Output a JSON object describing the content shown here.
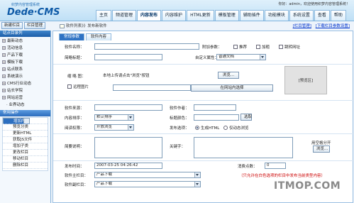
{
  "app": {
    "logo_sub": "织梦内容管理系统",
    "logo_main": "Dede·CMS"
  },
  "greeting": {
    "text": "你好：admin，欢迎使用织梦内容管理系统！"
  },
  "nav": [
    "主页",
    "频道管理",
    "内容发布",
    "内容维护",
    "HTML更新",
    "模板管理",
    "辅助插件",
    "功能模块",
    "系统设置",
    "查看",
    "帮助"
  ],
  "nav_active": 2,
  "top_buttons": {
    "new": "新建栏目",
    "manage": "栏目管理"
  },
  "breadcrumb": "软件列表》》发布新软件",
  "right_links": [
    "[栏目管理]",
    "[下载栏目参数设置]"
  ],
  "sidebar": {
    "header": "站点目录列",
    "tree": [
      "最新动态",
      "活动信息",
      "产品下载",
      "模板下载",
      "站点联系",
      "系统演示",
      "CMS行业动态",
      "站长学院",
      "网站运营"
    ],
    "tree_last": "· 业界动态",
    "section": "常用操作",
    "items": [
      "增加内容",
      "管理内容",
      "预览分类",
      "更新HTML",
      "获取JS文件",
      "增加子类",
      "更改栏目",
      "移动栏目",
      "删除栏目"
    ],
    "selected": 0
  },
  "tabs": [
    "常规参数",
    "软件内容"
  ],
  "form": {
    "software_name_label": "软件名称：",
    "attr_label": "附加参数：",
    "attr_opts": [
      "推荐",
      "加粗",
      "跳转网址"
    ],
    "brief_title_label": "简略标题：",
    "custom_attr_label": "自定义属性：",
    "custom_attr_value": "普通文档",
    "thumb_label": "缩 略 图：",
    "thumb_hint": "本地上传请点击\"浏览\"按钮",
    "browse": "浏览...",
    "remote_pic": "远程图片",
    "select_btn": "在网站内选择",
    "preview": "[预览区]",
    "source_label": "软件来源：",
    "author_label": "软件作者：",
    "sort_label": "内容排序：",
    "sort_value": "默认排序",
    "title_color_label": "标题颜色：",
    "pick_btn": "选取",
    "read_perm_label": "阅读权限：",
    "read_perm_value": "开放浏览",
    "publish_label": "发布选项：",
    "publish_opts": [
      "生成HTML",
      "仅动态浏览"
    ],
    "desc_label": "简要说明：",
    "keywords_label": "关键字：",
    "kw_btns": [
      "用空格分开",
      "浏览..."
    ],
    "time_label": "发布时间：",
    "time_value": "2007-03-25 04:26:42",
    "points_label": "消费点数：",
    "points_value": "0",
    "main_col_label": "软件主栏目：",
    "main_col_value": "产品下载",
    "main_col_note": "（只允许在白色选项的栏目中发布当前类型内容）",
    "sub_col_label": "软件副栏目：",
    "sub_col_value": "产品下载"
  },
  "watermark": "ITMOP.COM"
}
